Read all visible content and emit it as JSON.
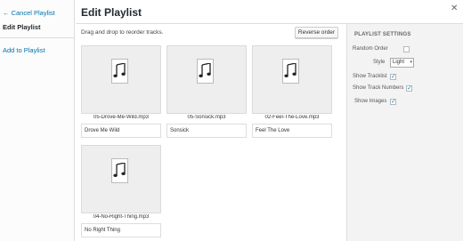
{
  "sidebar": {
    "cancel_label": "← Cancel Playlist",
    "current_label": "Edit Playlist",
    "add_label": "Add to Playlist"
  },
  "header": {
    "title": "Edit Playlist",
    "close_icon": "close-icon"
  },
  "toolbar": {
    "instructions": "Drag and drop to reorder tracks.",
    "reverse_label": "Reverse order"
  },
  "tracks": [
    {
      "filename": "05-Drove-Me-Wild.mp3",
      "caption": "Drove Me Wild",
      "icon": "audio-file-icon"
    },
    {
      "filename": "05-Sonsick.mp3",
      "caption": "Sonsick",
      "icon": "audio-file-icon"
    },
    {
      "filename": "02-Feel-The-Love.mp3",
      "caption": "Feel The Love",
      "icon": "audio-file-icon"
    },
    {
      "filename": "04-No-Right-Thing.mp3",
      "caption": "No Right Thing",
      "icon": "audio-file-icon"
    }
  ],
  "settings": {
    "title": "PLAYLIST SETTINGS",
    "random_order": {
      "label": "Random Order",
      "checked": false
    },
    "style": {
      "label": "Style",
      "value": "Light"
    },
    "show_tracklist": {
      "label": "Show Tracklist",
      "checked": true
    },
    "show_track_numbers": {
      "label": "Show Track Numbers",
      "checked": true
    },
    "show_images": {
      "label": "Show Images",
      "checked": true
    }
  },
  "colors": {
    "link": "#0073aa",
    "check": "#1e8cbe",
    "panel_bg": "#f3f3f3",
    "thumb_bg": "#eeeeee"
  }
}
